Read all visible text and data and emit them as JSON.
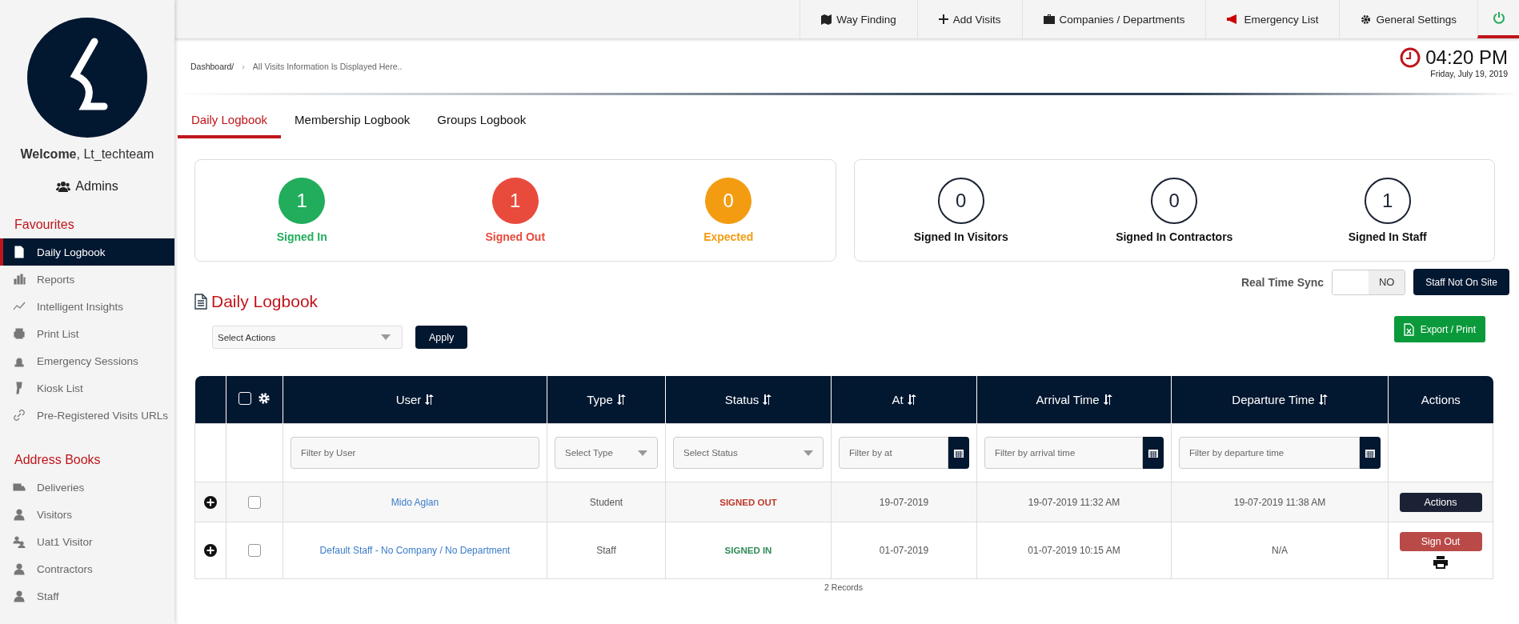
{
  "sidebar": {
    "welcome_bold": "Welcome",
    "welcome_name": ", Lt_techteam",
    "role": "Admins",
    "sections": [
      {
        "title": "Favourites",
        "items": [
          {
            "label": "Daily Logbook",
            "selected": true
          },
          {
            "label": "Reports",
            "selected": false
          },
          {
            "label": "Intelligent Insights",
            "selected": false
          },
          {
            "label": "Print List",
            "selected": false
          },
          {
            "label": "Emergency Sessions",
            "selected": false
          },
          {
            "label": "Kiosk List",
            "selected": false
          },
          {
            "label": "Pre-Registered Visits URLs",
            "selected": false
          }
        ]
      },
      {
        "title": "Address Books",
        "items": [
          {
            "label": "Deliveries",
            "selected": false
          },
          {
            "label": "Visitors",
            "selected": false
          },
          {
            "label": "Uat1 Visitor",
            "selected": false
          },
          {
            "label": "Contractors",
            "selected": false
          },
          {
            "label": "Staff",
            "selected": false
          }
        ]
      }
    ]
  },
  "top_nav": [
    {
      "label": "Way Finding"
    },
    {
      "label": "Add Visits"
    },
    {
      "label": "Companies / Departments"
    },
    {
      "label": "Emergency List"
    },
    {
      "label": "General Settings"
    }
  ],
  "breadcrumb": {
    "parent": "Dashboard/",
    "separator": "›",
    "current": "All Visits Information Is Displayed Here.."
  },
  "clock": {
    "time": "04:20 PM",
    "date": "Friday, July 19, 2019"
  },
  "tabs": [
    {
      "label": "Daily Logbook",
      "selected": true
    },
    {
      "label": "Membership Logbook",
      "selected": false
    },
    {
      "label": "Groups Logbook",
      "selected": false
    }
  ],
  "status_counts": [
    {
      "count": "1",
      "label": "Signed In",
      "color": "#21ad5b"
    },
    {
      "count": "1",
      "label": "Signed Out",
      "color": "#e84b3c"
    },
    {
      "count": "0",
      "label": "Expected",
      "color": "#f39c12"
    }
  ],
  "signed_in_counts": [
    {
      "count": "0",
      "label": "Signed In Visitors"
    },
    {
      "count": "0",
      "label": "Signed In Contractors"
    },
    {
      "count": "1",
      "label": "Signed In Staff"
    }
  ],
  "real_time_sync": {
    "label": "Real Time Sync",
    "on": false,
    "state_text": "NO"
  },
  "staff_button": "Staff Not On Site",
  "page_title": "Daily Logbook",
  "bulk_actions": {
    "placeholder": "Select Actions",
    "apply": "Apply"
  },
  "export_button": "Export / Print",
  "table": {
    "select_all_checked": false,
    "columns": [
      {
        "label": "User",
        "sortable": true
      },
      {
        "label": "Type",
        "sortable": true
      },
      {
        "label": "Status",
        "sortable": true
      },
      {
        "label": "At",
        "sortable": true
      },
      {
        "label": "Arrival Time",
        "sortable": true
      },
      {
        "label": "Departure Time",
        "sortable": true
      },
      {
        "label": "Actions",
        "sortable": false
      }
    ],
    "filters": [
      {
        "kind": "text",
        "placeholder": "Filter by User"
      },
      {
        "kind": "select",
        "placeholder": "Select Type"
      },
      {
        "kind": "select",
        "placeholder": "Select Status"
      },
      {
        "kind": "date",
        "placeholder": "Filter by at"
      },
      {
        "kind": "date",
        "placeholder": "Filter by arrival time"
      },
      {
        "kind": "date",
        "placeholder": "Filter by departure time"
      },
      {
        "kind": "none"
      }
    ],
    "rows": [
      {
        "checked": false,
        "user": "Mido Aglan",
        "type": "Student",
        "status": {
          "text": "SIGNED OUT",
          "color": "#c0392b"
        },
        "at": "19-07-2019",
        "arrival": "19-07-2019 11:32 AM",
        "departure": "19-07-2019 11:38 AM",
        "action": {
          "kind": "menu",
          "label": "Actions"
        }
      },
      {
        "checked": false,
        "user": "Default Staff - No Company / No Department",
        "type": "Staff",
        "status": {
          "text": "SIGNED IN",
          "color": "#2e8b57"
        },
        "at": "01-07-2019",
        "arrival": "01-07-2019 10:15 AM",
        "departure": "N/A",
        "action": {
          "kind": "sign_out",
          "label": "Sign Out"
        }
      }
    ],
    "records": "2 Records"
  }
}
